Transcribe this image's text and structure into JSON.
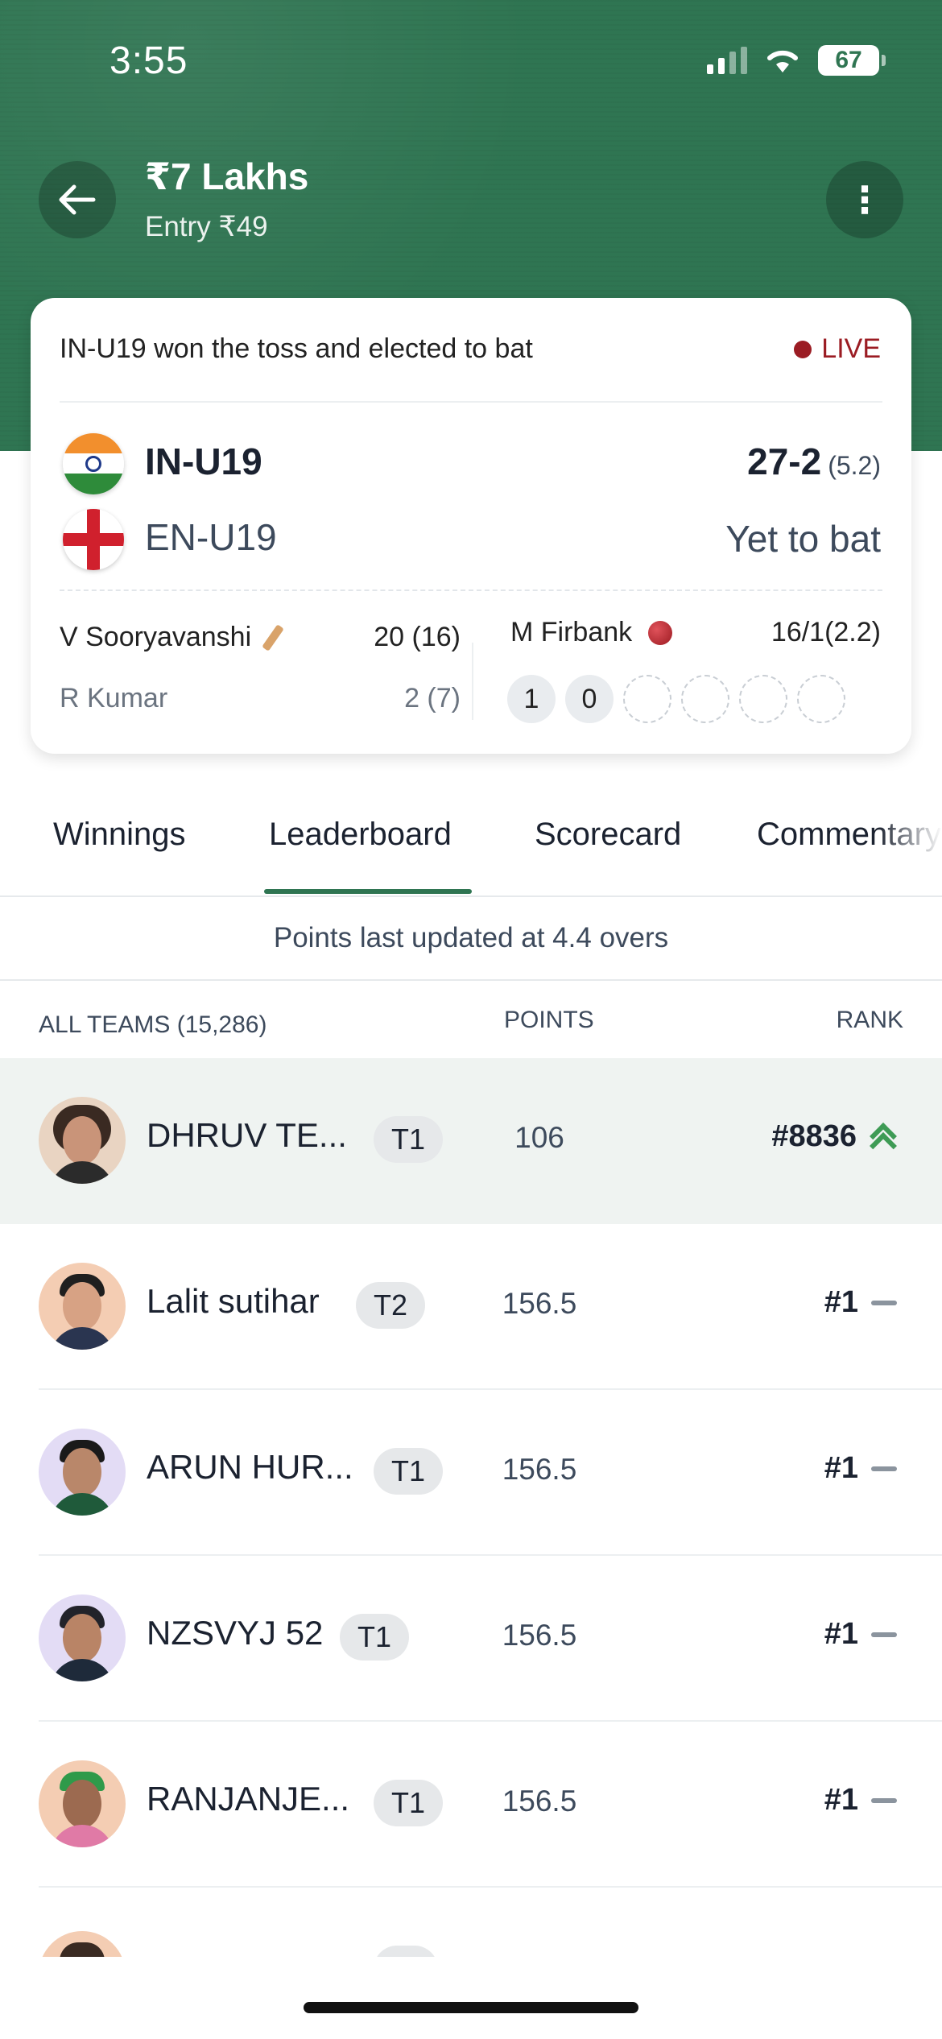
{
  "status_bar": {
    "time": "3:55",
    "battery": "67"
  },
  "header": {
    "title": "₹7 Lakhs",
    "entry": "Entry ₹49"
  },
  "match": {
    "toss_text": "IN-U19 won the toss and elected to bat",
    "live_label": "LIVE",
    "team1": {
      "name": "IN-U19",
      "score": "27-2",
      "overs": "(5.2)"
    },
    "team2": {
      "name": "EN-U19",
      "status": "Yet to bat"
    },
    "batsmen": [
      {
        "name": "V Sooryavanshi",
        "score": "20 (16)"
      },
      {
        "name": "R Kumar",
        "score": "2 (7)"
      }
    ],
    "bowler": {
      "name": "M Firbank",
      "figures": "16/1(2.2)"
    },
    "balls": [
      "1",
      "0",
      "",
      "",
      "",
      ""
    ]
  },
  "tabs": [
    "Winnings",
    "Leaderboard",
    "Scorecard",
    "Commentary"
  ],
  "active_tab": "Leaderboard",
  "points_updated": "Points last updated at 4.4 overs",
  "list_header": {
    "teams": "ALL TEAMS (15,286)",
    "points": "POINTS",
    "rank": "RANK"
  },
  "leaderboard": [
    {
      "name": "DHRUV TE...",
      "tag": "T1",
      "points": "106",
      "rank": "#8836",
      "trend": "up-icon"
    },
    {
      "name": "Lalit sutihar",
      "tag": "T2",
      "points": "156.5",
      "rank": "#1",
      "trend": "no-change-icon"
    },
    {
      "name": "ARUN HUR...",
      "tag": "T1",
      "points": "156.5",
      "rank": "#1",
      "trend": "no-change-icon"
    },
    {
      "name": "NZSVYJ 52",
      "tag": "T1",
      "points": "156.5",
      "rank": "#1",
      "trend": "no-change-icon"
    },
    {
      "name": "RANJANJE...",
      "tag": "T1",
      "points": "156.5",
      "rank": "#1",
      "trend": "no-change-icon"
    }
  ],
  "colors": {
    "brand_green": "#2f7552",
    "live_red": "#9b1c23",
    "rank_up_green": "#3e9b55"
  }
}
